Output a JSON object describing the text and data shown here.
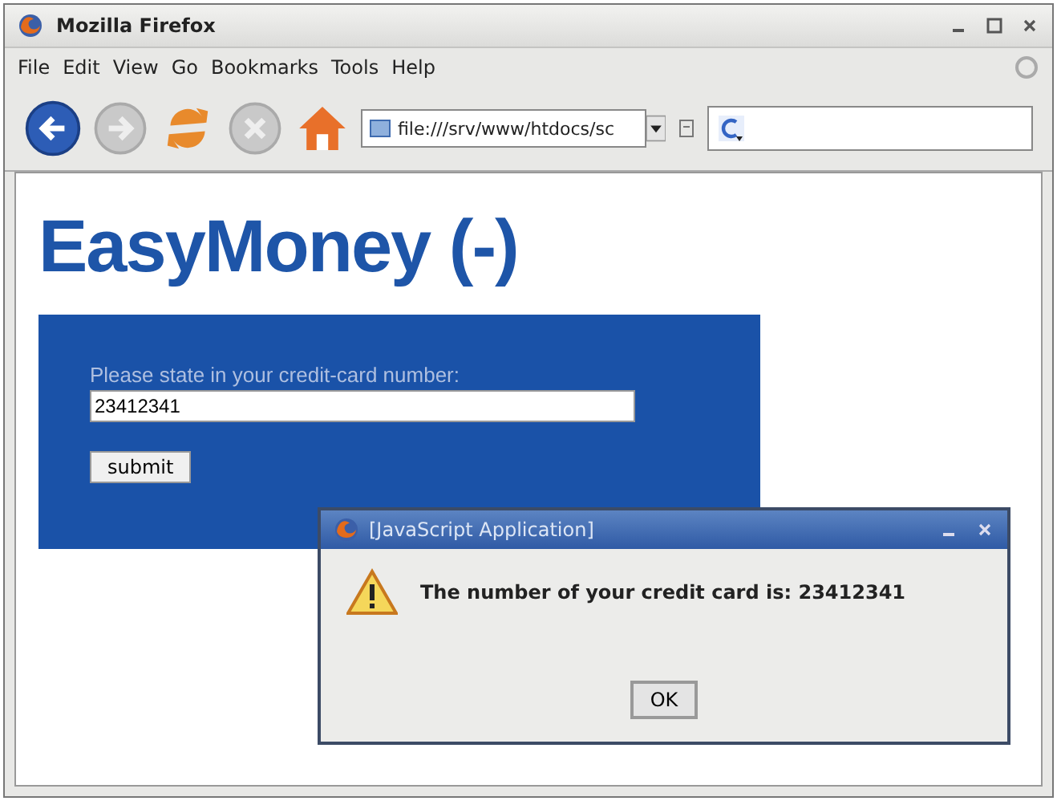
{
  "window": {
    "title": "Mozilla Firefox"
  },
  "menu": [
    "File",
    "Edit",
    "View",
    "Go",
    "Bookmarks",
    "Tools",
    "Help"
  ],
  "toolbar": {
    "address": "file:///srv/www/htdocs/sc",
    "back_disabled": false,
    "forward_disabled": true,
    "stop_disabled": true
  },
  "page": {
    "heading": "EasyMoney (-)",
    "form_label": "Please state in your credit-card number:",
    "card_number": "23412341",
    "submit": "submit"
  },
  "dialog": {
    "title": "[JavaScript Application]",
    "message": "The number of your credit card is: 23412341",
    "button": "OK"
  }
}
